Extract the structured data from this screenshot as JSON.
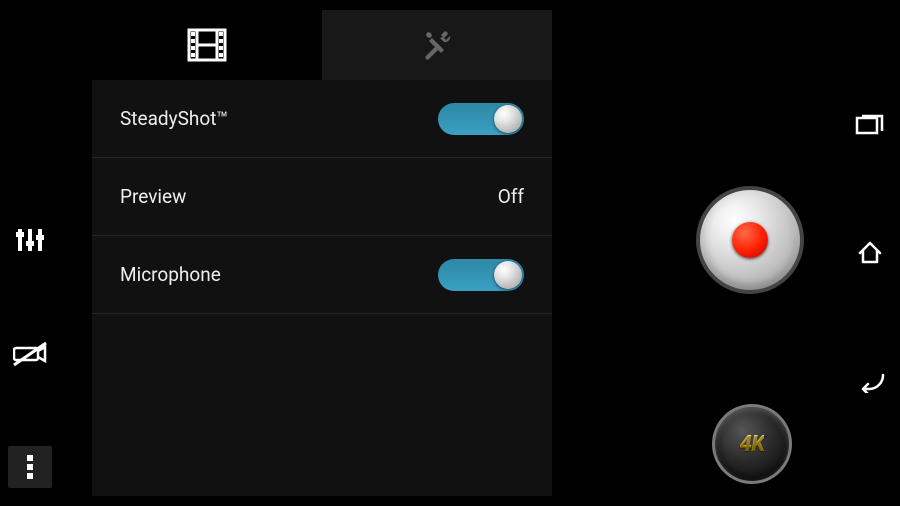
{
  "left_rail": {
    "sliders_icon": "sliders-icon",
    "camera_switch_off_icon": "camera-switch-off-icon",
    "menu_icon": "menu-dots-icon"
  },
  "panel": {
    "tabs": [
      {
        "icon": "film-icon",
        "active": true
      },
      {
        "icon": "tools-icon",
        "active": false
      }
    ],
    "rows": [
      {
        "label": "SteadyShot™",
        "type": "toggle",
        "value": "on"
      },
      {
        "label": "Preview",
        "type": "value",
        "value": "Off"
      },
      {
        "label": "Microphone",
        "type": "toggle",
        "value": "on"
      }
    ]
  },
  "right_rail": {
    "gallery_icon": "gallery-stack-icon",
    "home_icon": "home-icon",
    "back_icon": "back-icon"
  },
  "record": {
    "label": "record"
  },
  "mode_badge": {
    "text": "4K"
  }
}
